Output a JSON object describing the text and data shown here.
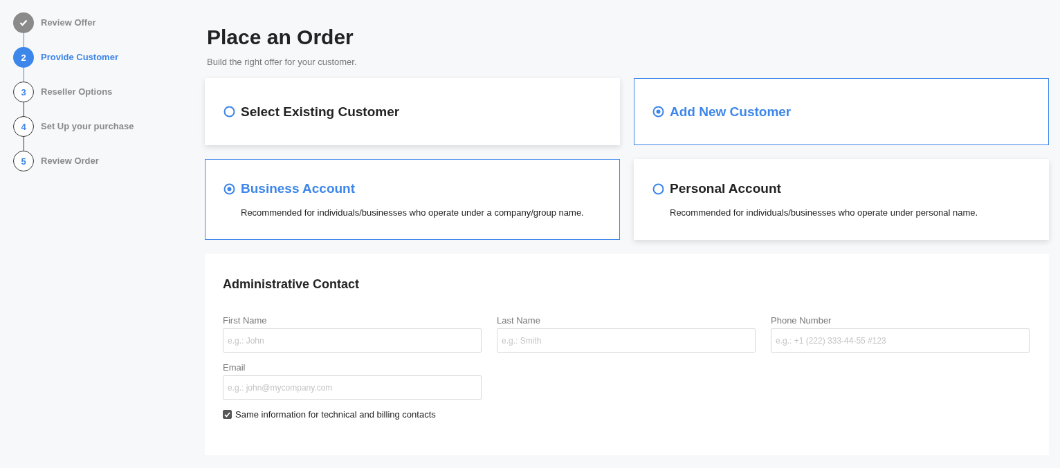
{
  "steps": [
    {
      "label": "Review Offer",
      "completed": true,
      "selected": false
    },
    {
      "number": "2",
      "label": "Provide Customer",
      "completed": false,
      "selected": true
    },
    {
      "number": "3",
      "label": "Reseller Options",
      "completed": false,
      "selected": false
    },
    {
      "number": "4",
      "label": "Set Up your purchase",
      "completed": false,
      "selected": false
    },
    {
      "number": "5",
      "label": "Review Order",
      "completed": false,
      "selected": false
    }
  ],
  "title": "Place an Order",
  "subtitle": "Build the right offer for your customer.",
  "customer_options": [
    {
      "label": "Select Existing Customer",
      "selected": false
    },
    {
      "label": "Add New Customer",
      "selected": true
    }
  ],
  "account_options": [
    {
      "label": "Business Account",
      "description": "Recommended for individuals/businesses who operate under a company/group name.",
      "selected": true
    },
    {
      "label": "Personal Account",
      "description": "Recommended for individuals/businesses who operate under personal name.",
      "selected": false
    }
  ],
  "contact": {
    "heading": "Administrative Contact",
    "fields": [
      {
        "label": "First Name",
        "placeholder": "e.g.: John"
      },
      {
        "label": "Last Name",
        "placeholder": "e.g.: Smith"
      },
      {
        "label": "Phone Number",
        "placeholder": "e.g.: +1 (222) 333-44-55 #123"
      },
      {
        "label": "Email",
        "placeholder": "e.g.: john@mycompany.com"
      }
    ],
    "same_info": {
      "label": "Same information for technical and billing contacts",
      "checked": true
    }
  }
}
